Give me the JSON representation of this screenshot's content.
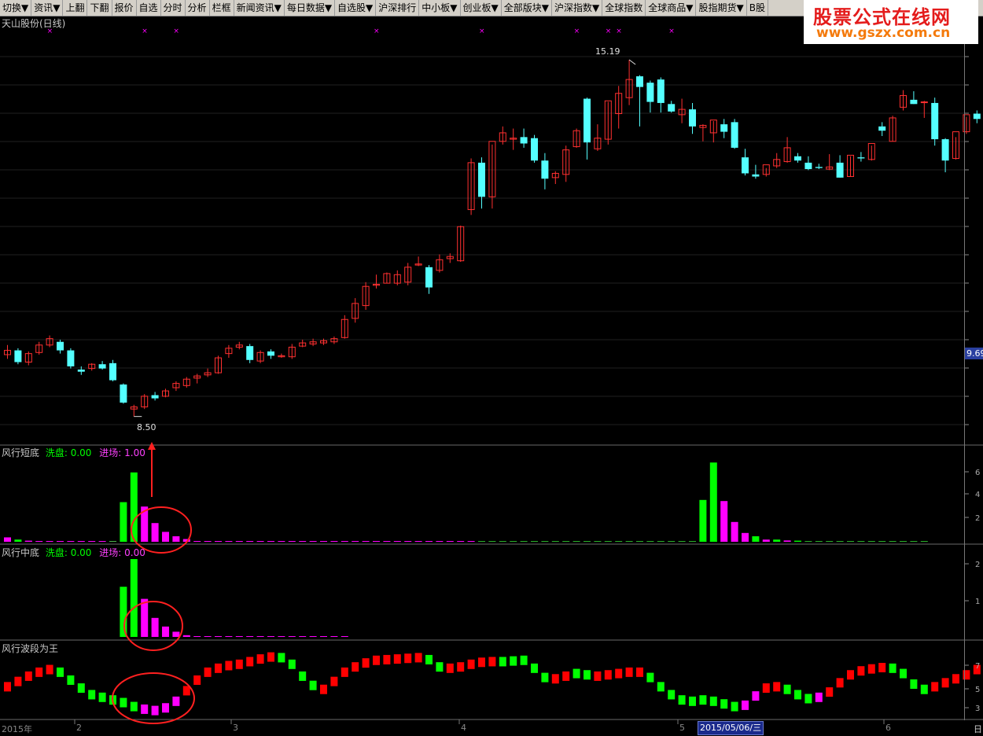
{
  "menu": [
    "切换▼",
    "资讯▼",
    "上翻",
    "下翻",
    "报价",
    "自选",
    "分时",
    "分析",
    "栏框",
    "新闻资讯▼",
    "每日数据▼",
    "自选股▼",
    "沪深排行",
    "中小板▼",
    "创业板▼",
    "全部版块▼",
    "沪深指数▼",
    "全球指数",
    "全球商品▼",
    "股指期货▼",
    "B股"
  ],
  "watermark": {
    "line1": "股票公式在线网",
    "line2": "www.gszx.com.cn"
  },
  "main": {
    "title": "天山股份(日线)",
    "high_label": "15.19",
    "low_label": "8.50",
    "price_tag": "9.69"
  },
  "panel1": {
    "name": "风行短底",
    "k1": "洗盘:",
    "v1": "0.00",
    "k2": "进场:",
    "v2": "1.00"
  },
  "panel2": {
    "name": "风行中底",
    "k1": "洗盘:",
    "v1": "0.00",
    "k2": "进场:",
    "v2": "0.00"
  },
  "panel3": {
    "name": "风行波段为王"
  },
  "xaxis": {
    "start": "2015年",
    "m2": "2",
    "m3": "3",
    "m4": "4",
    "m5": "5",
    "m6": "6",
    "cursor_date": "2015/05/06/三",
    "right": "日"
  },
  "colors": {
    "up": "#ff3030",
    "down": "#54ffff",
    "green": "#00ff00",
    "magenta": "#ff00ff",
    "red": "#ff0000"
  },
  "candles": [
    [
      9.66,
      9.84,
      9.58,
      9.74
    ],
    [
      9.74,
      9.78,
      9.48,
      9.52
    ],
    [
      9.52,
      9.72,
      9.46,
      9.68
    ],
    [
      9.7,
      9.9,
      9.66,
      9.84
    ],
    [
      9.84,
      10.02,
      9.8,
      9.96
    ],
    [
      9.9,
      9.94,
      9.68,
      9.74
    ],
    [
      9.74,
      9.78,
      9.4,
      9.44
    ],
    [
      9.38,
      9.44,
      9.28,
      9.34
    ],
    [
      9.4,
      9.5,
      9.36,
      9.48
    ],
    [
      9.48,
      9.54,
      9.38,
      9.4
    ],
    [
      9.5,
      9.56,
      9.16,
      9.18
    ],
    [
      9.1,
      9.12,
      8.74,
      8.76
    ],
    [
      8.64,
      8.72,
      8.5,
      8.68
    ],
    [
      8.68,
      8.92,
      8.64,
      8.88
    ],
    [
      8.9,
      8.96,
      8.8,
      8.84
    ],
    [
      8.88,
      9.02,
      8.86,
      8.98
    ],
    [
      9.04,
      9.16,
      8.98,
      9.12
    ],
    [
      9.08,
      9.24,
      9.04,
      9.2
    ],
    [
      9.22,
      9.3,
      9.12,
      9.26
    ],
    [
      9.28,
      9.4,
      9.24,
      9.32
    ],
    [
      9.32,
      9.64,
      9.3,
      9.6
    ],
    [
      9.68,
      9.84,
      9.6,
      9.78
    ],
    [
      9.8,
      9.9,
      9.76,
      9.84
    ],
    [
      9.82,
      9.86,
      9.5,
      9.56
    ],
    [
      9.54,
      9.74,
      9.5,
      9.7
    ],
    [
      9.72,
      9.76,
      9.58,
      9.64
    ],
    [
      9.62,
      9.68,
      9.6,
      9.64
    ],
    [
      9.62,
      9.86,
      9.58,
      9.8
    ],
    [
      9.82,
      9.94,
      9.8,
      9.88
    ],
    [
      9.86,
      9.96,
      9.82,
      9.9
    ],
    [
      9.88,
      9.96,
      9.84,
      9.92
    ],
    [
      9.9,
      10.0,
      9.86,
      9.96
    ],
    [
      9.98,
      10.4,
      9.96,
      10.32
    ],
    [
      10.34,
      10.72,
      10.26,
      10.62
    ],
    [
      10.58,
      11.02,
      10.5,
      10.94
    ],
    [
      10.96,
      11.16,
      10.9,
      10.98
    ],
    [
      11.0,
      11.2,
      11.0,
      11.18
    ],
    [
      11.0,
      11.24,
      10.96,
      11.16
    ],
    [
      11.02,
      11.38,
      10.96,
      11.3
    ],
    [
      11.34,
      11.5,
      11.32,
      11.36
    ],
    [
      11.3,
      11.34,
      10.8,
      10.92
    ],
    [
      11.24,
      11.54,
      11.2,
      11.44
    ],
    [
      11.46,
      11.56,
      11.38,
      11.5
    ],
    [
      11.42,
      12.08,
      11.4,
      12.06
    ],
    [
      12.38,
      13.34,
      12.28,
      13.26
    ],
    [
      13.26,
      13.36,
      12.4,
      12.62
    ],
    [
      12.62,
      13.6,
      12.4,
      13.66
    ],
    [
      13.66,
      13.94,
      13.6,
      13.82
    ],
    [
      13.7,
      13.9,
      13.5,
      13.72
    ],
    [
      13.74,
      13.9,
      13.54,
      13.62
    ],
    [
      13.72,
      13.78,
      13.26,
      13.3
    ],
    [
      13.3,
      13.44,
      12.76,
      12.96
    ],
    [
      12.98,
      13.1,
      12.86,
      13.06
    ],
    [
      13.04,
      13.58,
      12.9,
      13.5
    ],
    [
      13.56,
      13.9,
      13.54,
      13.86
    ],
    [
      14.46,
      14.48,
      13.32,
      13.64
    ],
    [
      13.52,
      13.98,
      13.48,
      13.72
    ],
    [
      13.7,
      14.4,
      13.6,
      14.42
    ],
    [
      14.18,
      14.7,
      13.9,
      14.56
    ],
    [
      14.48,
      15.19,
      14.34,
      14.82
    ],
    [
      14.88,
      14.9,
      13.94,
      14.68
    ],
    [
      14.76,
      14.8,
      14.2,
      14.4
    ],
    [
      14.82,
      14.86,
      14.2,
      14.38
    ],
    [
      14.36,
      14.42,
      14.2,
      14.22
    ],
    [
      14.16,
      14.46,
      14.0,
      14.26
    ],
    [
      14.26,
      14.38,
      13.8,
      13.94
    ],
    [
      13.92,
      13.98,
      13.66,
      13.96
    ],
    [
      13.82,
      14.04,
      13.64,
      14.06
    ],
    [
      13.98,
      14.08,
      13.72,
      13.84
    ],
    [
      14.02,
      14.08,
      13.52,
      13.54
    ],
    [
      13.36,
      13.52,
      13.02,
      13.06
    ],
    [
      13.04,
      13.22,
      12.96,
      13.0
    ],
    [
      13.04,
      13.16,
      13.0,
      13.22
    ],
    [
      13.2,
      13.44,
      13.16,
      13.32
    ],
    [
      13.28,
      13.74,
      13.26,
      13.54
    ],
    [
      13.38,
      13.44,
      13.26,
      13.3
    ],
    [
      13.26,
      13.38,
      13.12,
      13.14
    ],
    [
      13.18,
      13.24,
      13.14,
      13.16
    ],
    [
      13.14,
      13.42,
      13.12,
      13.18
    ],
    [
      13.26,
      13.4,
      12.98,
      12.98
    ],
    [
      13.0,
      13.38,
      13.0,
      13.4
    ],
    [
      13.36,
      13.46,
      13.28,
      13.34
    ],
    [
      13.32,
      13.58,
      13.3,
      13.62
    ],
    [
      13.94,
      14.02,
      13.76,
      13.86
    ],
    [
      13.66,
      14.14,
      13.66,
      14.1
    ],
    [
      14.3,
      14.62,
      14.24,
      14.52
    ],
    [
      14.44,
      14.6,
      14.36,
      14.36
    ],
    [
      14.4,
      14.42,
      14.1,
      14.4
    ],
    [
      14.38,
      14.48,
      13.58,
      13.7
    ],
    [
      13.7,
      13.72,
      13.08,
      13.3
    ],
    [
      13.34,
      13.74,
      13.32,
      13.84
    ],
    [
      13.84,
      14.12,
      13.8,
      14.16
    ],
    [
      14.18,
      14.24,
      14.0,
      14.08
    ],
    [
      14.06,
      14.32,
      13.56,
      14.34
    ],
    [
      14.52,
      14.98,
      14.4,
      14.94
    ]
  ],
  "short_bars": [
    [
      0,
      0.4,
      "m"
    ],
    [
      1,
      0.2,
      "g"
    ],
    [
      2,
      0.1,
      "m"
    ],
    [
      10,
      0.05,
      "g"
    ],
    [
      11,
      3.6,
      "g"
    ],
    [
      12,
      6.3,
      "g"
    ],
    [
      13,
      3.2,
      "m"
    ],
    [
      14,
      1.7,
      "m"
    ],
    [
      15,
      0.9,
      "m"
    ],
    [
      16,
      0.5,
      "m"
    ],
    [
      17,
      0.25,
      "m"
    ],
    [
      66,
      3.8,
      "g"
    ],
    [
      67,
      7.2,
      "g"
    ],
    [
      68,
      3.7,
      "m"
    ],
    [
      69,
      1.8,
      "m"
    ],
    [
      70,
      0.8,
      "m"
    ],
    [
      71,
      0.5,
      "g"
    ],
    [
      72,
      0.2,
      "m"
    ],
    [
      73,
      0.2,
      "g"
    ],
    [
      74,
      0.12,
      "m"
    ],
    [
      75,
      0.1,
      "g"
    ]
  ],
  "mid_bars": [
    [
      11,
      1.45,
      "g"
    ],
    [
      12,
      2.25,
      "g"
    ],
    [
      13,
      1.1,
      "m"
    ],
    [
      14,
      0.55,
      "m"
    ],
    [
      15,
      0.3,
      "m"
    ],
    [
      16,
      0.15,
      "m"
    ],
    [
      17,
      0.05,
      "m"
    ]
  ],
  "wave": [
    [
      4.6,
      "r"
    ],
    [
      5.4,
      "r"
    ],
    [
      6.2,
      "r"
    ],
    [
      6.8,
      "r"
    ],
    [
      7.2,
      "r"
    ],
    [
      6.8,
      "g"
    ],
    [
      5.6,
      "g"
    ],
    [
      4.4,
      "g"
    ],
    [
      3.4,
      "g"
    ],
    [
      3.0,
      "g"
    ],
    [
      2.6,
      "g"
    ],
    [
      2.2,
      "g"
    ],
    [
      1.6,
      "g"
    ],
    [
      1.2,
      "m"
    ],
    [
      1.0,
      "m"
    ],
    [
      1.4,
      "m"
    ],
    [
      2.4,
      "m"
    ],
    [
      4.0,
      "r"
    ],
    [
      5.6,
      "r"
    ],
    [
      6.8,
      "r"
    ],
    [
      7.4,
      "r"
    ],
    [
      7.8,
      "r"
    ],
    [
      8.0,
      "r"
    ],
    [
      8.4,
      "r"
    ],
    [
      8.8,
      "r"
    ],
    [
      9.1,
      "r"
    ],
    [
      9.0,
      "g"
    ],
    [
      8.0,
      "g"
    ],
    [
      6.2,
      "g"
    ],
    [
      4.8,
      "g"
    ],
    [
      4.2,
      "r"
    ],
    [
      5.4,
      "r"
    ],
    [
      6.8,
      "r"
    ],
    [
      7.6,
      "r"
    ],
    [
      8.2,
      "r"
    ],
    [
      8.6,
      "r"
    ],
    [
      8.7,
      "r"
    ],
    [
      8.8,
      "r"
    ],
    [
      8.9,
      "r"
    ],
    [
      9.0,
      "r"
    ],
    [
      8.7,
      "g"
    ],
    [
      7.6,
      "g"
    ],
    [
      7.4,
      "r"
    ],
    [
      7.6,
      "r"
    ],
    [
      8.0,
      "r"
    ],
    [
      8.3,
      "r"
    ],
    [
      8.4,
      "r"
    ],
    [
      8.4,
      "g"
    ],
    [
      8.5,
      "g"
    ],
    [
      8.6,
      "g"
    ],
    [
      7.4,
      "g"
    ],
    [
      6.0,
      "g"
    ],
    [
      5.8,
      "r"
    ],
    [
      6.2,
      "r"
    ],
    [
      6.6,
      "g"
    ],
    [
      6.4,
      "g"
    ],
    [
      6.2,
      "r"
    ],
    [
      6.4,
      "r"
    ],
    [
      6.6,
      "r"
    ],
    [
      6.8,
      "r"
    ],
    [
      6.8,
      "r"
    ],
    [
      6.0,
      "g"
    ],
    [
      4.6,
      "g"
    ],
    [
      3.4,
      "g"
    ],
    [
      2.6,
      "g"
    ],
    [
      2.4,
      "g"
    ],
    [
      2.6,
      "g"
    ],
    [
      2.4,
      "g"
    ],
    [
      2.0,
      "g"
    ],
    [
      1.6,
      "g"
    ],
    [
      1.8,
      "m"
    ],
    [
      3.2,
      "m"
    ],
    [
      4.4,
      "r"
    ],
    [
      4.6,
      "r"
    ],
    [
      4.2,
      "g"
    ],
    [
      3.4,
      "g"
    ],
    [
      2.8,
      "g"
    ],
    [
      3.0,
      "m"
    ],
    [
      3.8,
      "r"
    ],
    [
      5.2,
      "r"
    ],
    [
      6.4,
      "r"
    ],
    [
      7.0,
      "r"
    ],
    [
      7.3,
      "r"
    ],
    [
      7.5,
      "r"
    ],
    [
      7.4,
      "g"
    ],
    [
      6.6,
      "g"
    ],
    [
      5.0,
      "g"
    ],
    [
      4.2,
      "g"
    ],
    [
      4.6,
      "r"
    ],
    [
      5.2,
      "r"
    ],
    [
      5.8,
      "r"
    ],
    [
      6.4,
      "r"
    ],
    [
      7.2,
      "r"
    ]
  ],
  "signal_marks": [
    4,
    13,
    16,
    35,
    45,
    54,
    57,
    58,
    63
  ]
}
